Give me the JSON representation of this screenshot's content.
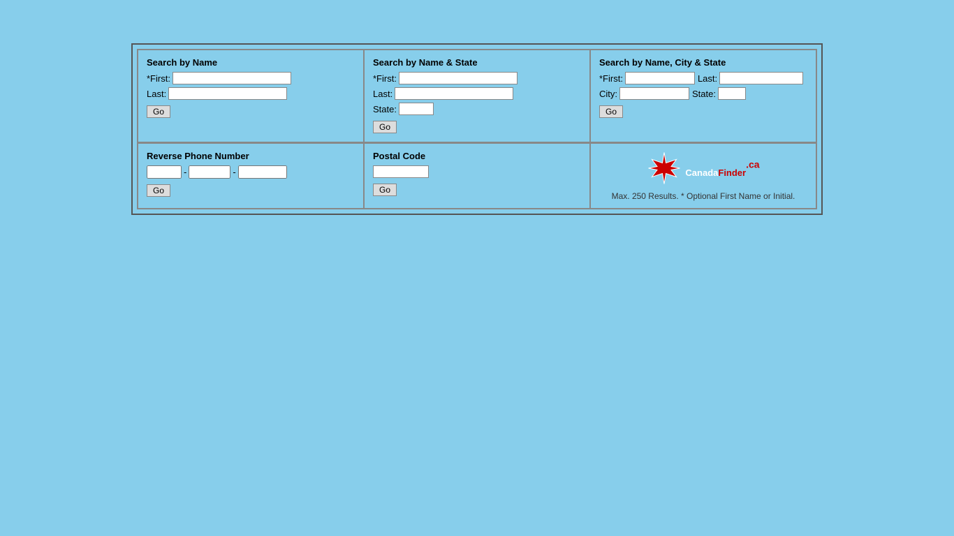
{
  "page": {
    "background": "#87CEEB"
  },
  "section1": {
    "title": "Search by Name",
    "first_label": "*First:",
    "last_label": "Last:",
    "go_label": "Go"
  },
  "section2": {
    "title": "Search by Name & State",
    "first_label": "*First:",
    "last_label": "Last:",
    "state_label": "State:",
    "go_label": "Go"
  },
  "section3": {
    "title": "Search by Name, City & State",
    "first_label": "*First:",
    "last_label": "Last:",
    "city_label": "City:",
    "state_label": "State:",
    "go_label": "Go"
  },
  "section4": {
    "title": "Reverse Phone Number",
    "go_label": "Go"
  },
  "section5": {
    "title": "Postal Code",
    "go_label": "Go"
  },
  "logo": {
    "canada_text": "Canada",
    "finder_text": "Finder",
    "ca_text": ".ca",
    "note": "Max. 250 Results. * Optional First Name or Initial."
  }
}
